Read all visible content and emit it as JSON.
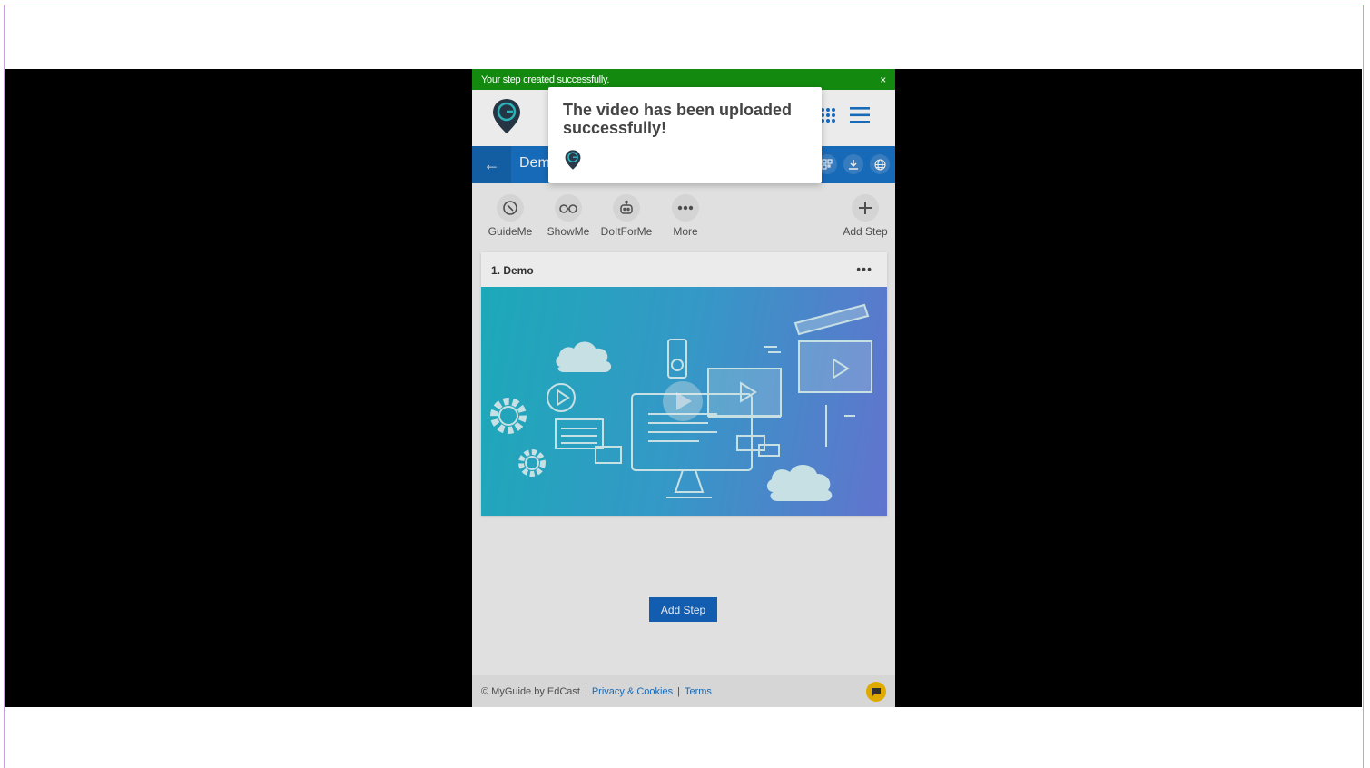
{
  "toast": {
    "message": "Your step created successfully.",
    "close": "×"
  },
  "header": {
    "title": "Dem"
  },
  "tools": [
    {
      "label": "GuideMe",
      "icon": "compass-icon"
    },
    {
      "label": "ShowMe",
      "icon": "binoculars-icon"
    },
    {
      "label": "DoItForMe",
      "icon": "robot-icon"
    },
    {
      "label": "More",
      "icon": "more-dots-icon"
    },
    {
      "label": "Add Step",
      "icon": "plus-icon"
    }
  ],
  "step": {
    "title": "1. Demo",
    "menu": "•••"
  },
  "add_step_button": "Add Step",
  "footer": {
    "copyright": "© MyGuide by EdCast",
    "privacy": "Privacy & Cookies",
    "terms": "Terms",
    "separator": "|"
  },
  "popup": {
    "message": "The video has been uploaded successfully!"
  },
  "colors": {
    "toast": "#138a0f",
    "header": "#1a73c8",
    "button": "#1565c0",
    "chat": "#f2b900"
  }
}
